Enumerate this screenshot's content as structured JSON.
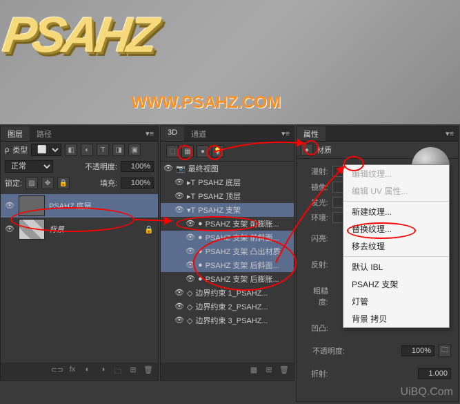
{
  "viewport": {
    "text3d": "PSAHZ",
    "url": "WWW.PSAHZ.COM"
  },
  "watermark": "UiBQ.Com",
  "layers": {
    "tabs": [
      "图层",
      "路径"
    ],
    "type_label": "类型",
    "blend": "正常",
    "opacity_label": "不透明度:",
    "opacity": "100%",
    "lock_label": "锁定:",
    "fill_label": "填充:",
    "fill": "100%",
    "items": [
      {
        "name": "PSAHZ 底层",
        "sel": true
      },
      {
        "name": "背景",
        "sel": false
      }
    ]
  },
  "d3": {
    "tabs": [
      "3D",
      "通道"
    ],
    "items": [
      {
        "name": "最终视图",
        "i": 0
      },
      {
        "name": "PSAHZ 底层",
        "i": 1
      },
      {
        "name": "PSAHZ 顶层",
        "i": 1
      },
      {
        "name": "PSAHZ 支架",
        "i": 1,
        "sel": true,
        "exp": true
      },
      {
        "name": "PSAHZ 支架 前膨胀...",
        "i": 2
      },
      {
        "name": "PSAHZ 支架 前斜面...",
        "i": 2,
        "sel": true
      },
      {
        "name": "PSAHZ 支架 凸出材质",
        "i": 2,
        "sel": true
      },
      {
        "name": "PSAHZ 支架 后斜面...",
        "i": 2,
        "sel": true
      },
      {
        "name": "PSAHZ 支架 后膨胀...",
        "i": 2
      },
      {
        "name": "边界约束 1_PSAHZ...",
        "i": 1
      },
      {
        "name": "边界约束 2_PSAHZ...",
        "i": 1
      },
      {
        "name": "边界约束 3_PSAHZ...",
        "i": 1
      }
    ]
  },
  "props": {
    "tab": "属性",
    "title": "材质",
    "rows": {
      "diffuse": "漫射:",
      "specular": "镜像:",
      "glow": "发光:",
      "ambient": "环境:",
      "shine": "闪亮:",
      "reflect": "反射:",
      "rough": "粗糙度:",
      "bump": "凹凸:",
      "opacity": "不透明度:",
      "refraction": "折射:"
    },
    "opacity_val": "100%",
    "refraction_val": "1.000"
  },
  "menu": {
    "edit_tex": "编辑纹理...",
    "edit_uv": "编辑 UV 属性...",
    "new_tex": "新建纹理...",
    "replace_tex": "替换纹理...",
    "remove_tex": "移去纹理",
    "default_ibl": "默认 IBL",
    "psahz": "PSAHZ 支架",
    "tube": "灯管",
    "bg_copy": "背景 拷贝"
  }
}
